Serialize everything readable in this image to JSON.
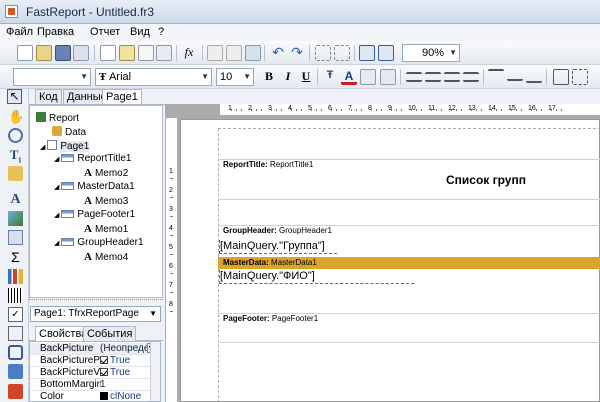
{
  "app": {
    "title": "FastReport - Untitled.fr3"
  },
  "menu": [
    "Файл",
    "Правка",
    "Отчет",
    "Вид",
    "?"
  ],
  "toolbar": {
    "zoom": "90%",
    "font_name": "Arial",
    "font_size": "10"
  },
  "tabs": {
    "left": [
      "Код",
      "Данные",
      "Page1"
    ]
  },
  "tree": [
    {
      "label": "Report",
      "icon": "report-icon"
    },
    {
      "label": "Data",
      "icon": "data-icon"
    },
    {
      "label": "Page1",
      "icon": "page-icon"
    },
    {
      "label": "ReportTitle1",
      "icon": "band-icon"
    },
    {
      "label": "Memo2",
      "icon": "text-memo-icon"
    },
    {
      "label": "MasterData1",
      "icon": "band-icon"
    },
    {
      "label": "Memo3",
      "icon": "text-memo-icon"
    },
    {
      "label": "PageFooter1",
      "icon": "band-icon"
    },
    {
      "label": "Memo1",
      "icon": "text-memo-icon"
    },
    {
      "label": "GroupHeader1",
      "icon": "band-icon"
    },
    {
      "label": "Memo4",
      "icon": "text-memo-icon"
    }
  ],
  "object_selector": "Page1: TfrxReportPage",
  "inspector_tabs": [
    "Свойства",
    "События"
  ],
  "properties": [
    {
      "name": "BackPicture",
      "value": "(Неопределен)"
    },
    {
      "name": "BackPicturePri",
      "value": "True"
    },
    {
      "name": "BackPictureVis",
      "value": "True"
    },
    {
      "name": "BottomMargin",
      "value": "1"
    },
    {
      "name": "Color",
      "value": "clNone"
    }
  ],
  "ruler": {
    "h": [
      "1",
      "2",
      "3",
      "4",
      "5",
      "6",
      "7",
      "8",
      "9",
      "10",
      "11",
      "12",
      "13",
      "14",
      "15",
      "16",
      "17"
    ],
    "v": [
      "1",
      "2",
      "3",
      "4",
      "5",
      "6",
      "7",
      "8"
    ]
  },
  "bands": {
    "report_title": {
      "type": "ReportTitle:",
      "name": "ReportTitle1",
      "memo": "Список групп"
    },
    "group_header": {
      "type": "GroupHeader:",
      "name": "GroupHeader1",
      "memo": "[MainQuery.\"Группа\"]"
    },
    "master_data": {
      "type": "MasterData:",
      "name": "MasterData1",
      "memo": "[MainQuery.\"ФИО\"]"
    },
    "page_footer": {
      "type": "PageFooter:",
      "name": "PageFooter1"
    }
  },
  "colors": {
    "masterdata_band": "#dca42a"
  }
}
